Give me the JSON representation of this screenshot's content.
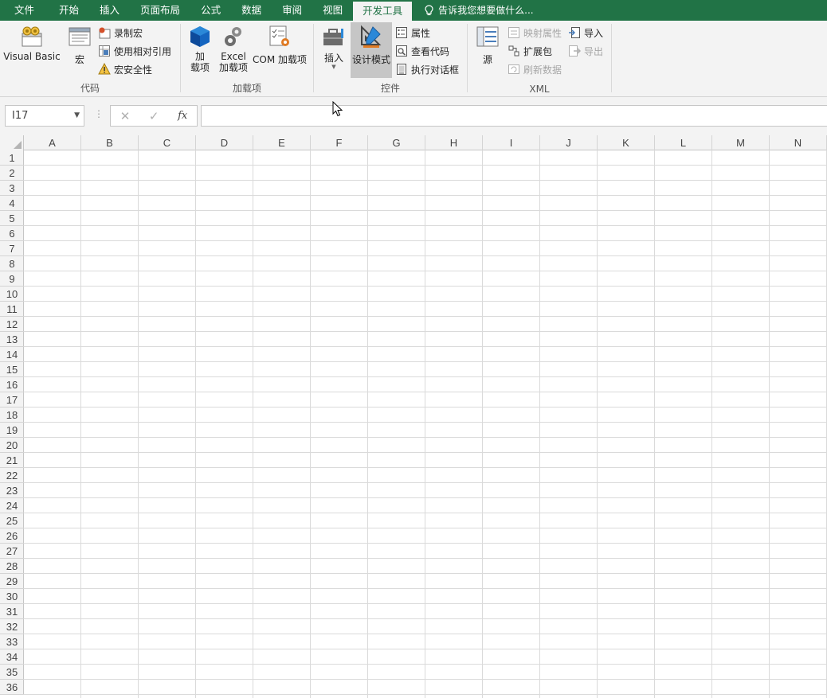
{
  "tabs": [
    {
      "label": "文件",
      "active": false
    },
    {
      "label": "开始",
      "active": false
    },
    {
      "label": "插入",
      "active": false
    },
    {
      "label": "页面布局",
      "active": false
    },
    {
      "label": "公式",
      "active": false
    },
    {
      "label": "数据",
      "active": false
    },
    {
      "label": "审阅",
      "active": false
    },
    {
      "label": "视图",
      "active": false
    },
    {
      "label": "开发工具",
      "active": true
    }
  ],
  "tell_me": "告诉我您想要做什么...",
  "ribbon": {
    "code": {
      "label": "代码",
      "visual_basic": "Visual Basic",
      "macros": "宏",
      "record_macro": "录制宏",
      "relative_ref": "使用相对引用",
      "macro_security": "宏安全性"
    },
    "addins": {
      "label": "加载项",
      "addins_line1": "加",
      "addins_line2": "载项",
      "excel_addins_line1": "Excel",
      "excel_addins_line2": "加载项",
      "com_addins": "COM 加载项"
    },
    "controls": {
      "label": "控件",
      "insert": "插入",
      "design_mode": "设计模式",
      "properties": "属性",
      "view_code": "查看代码",
      "run_dialog": "执行对话框"
    },
    "xml": {
      "label": "XML",
      "source": "源",
      "map_properties": "映射属性",
      "expansion_packs": "扩展包",
      "refresh_data": "刷新数据",
      "import": "导入",
      "export": "导出"
    }
  },
  "formula_bar": {
    "name_box": "I17",
    "fx": "fx",
    "value": ""
  },
  "columns": [
    "A",
    "B",
    "C",
    "D",
    "E",
    "F",
    "G",
    "H",
    "I",
    "J",
    "K",
    "L",
    "M",
    "N"
  ],
  "rows": [
    "1",
    "2",
    "3",
    "4",
    "5",
    "6",
    "7",
    "8",
    "9",
    "10",
    "11",
    "12",
    "13",
    "14",
    "15",
    "16",
    "17",
    "18",
    "19",
    "20",
    "21",
    "22",
    "23",
    "24",
    "25",
    "26",
    "27",
    "28",
    "29",
    "30",
    "31",
    "32",
    "33",
    "34",
    "35",
    "36"
  ],
  "colors": {
    "brand": "#217346",
    "ribbon_bg": "#f3f3f3",
    "gridline": "#dadada"
  }
}
